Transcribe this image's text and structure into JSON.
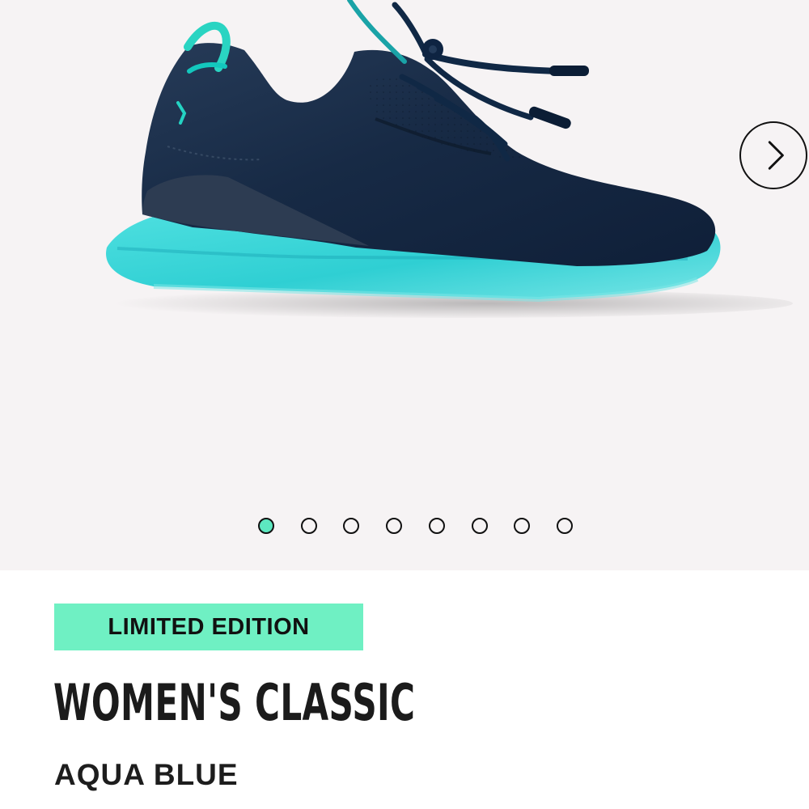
{
  "gallery": {
    "background_color": "#f6f3f4",
    "product_image": "navy-and-aqua-sneaker",
    "next_icon": "chevron-right-icon",
    "slide_count": 8,
    "active_slide": 1,
    "dot_active_color": "#5de8c0"
  },
  "product": {
    "badge": "LIMITED EDITION",
    "badge_color": "#6ff0c3",
    "title": "WOMEN'S CLASSIC",
    "color_name": "AQUA BLUE"
  }
}
